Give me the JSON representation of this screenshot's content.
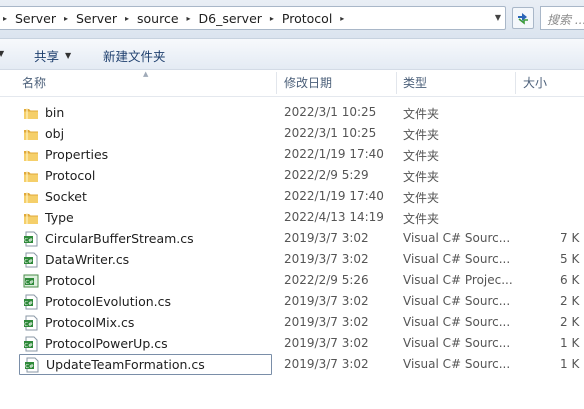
{
  "address": {
    "crumbs": [
      "Server",
      "Server",
      "source",
      "D6_server",
      "Protocol"
    ],
    "search_placeholder": "搜索 ..."
  },
  "toolbar": {
    "share_label": "共享",
    "new_folder_label": "新建文件夹"
  },
  "columns": {
    "name": "名称",
    "date": "修改日期",
    "type": "类型",
    "size": "大小"
  },
  "colors": {
    "folder": "#e8b84a",
    "selection_border": "#7a8ea8",
    "link_text": "#1e3f6e"
  },
  "files": [
    {
      "name": "bin",
      "date": "2022/3/1 10:25",
      "type": "文件夹",
      "size": "",
      "icon": "folder-icon"
    },
    {
      "name": "obj",
      "date": "2022/3/1 10:25",
      "type": "文件夹",
      "size": "",
      "icon": "folder-icon"
    },
    {
      "name": "Properties",
      "date": "2022/1/19 17:40",
      "type": "文件夹",
      "size": "",
      "icon": "folder-icon"
    },
    {
      "name": "Protocol",
      "date": "2022/2/9 5:29",
      "type": "文件夹",
      "size": "",
      "icon": "folder-icon"
    },
    {
      "name": "Socket",
      "date": "2022/1/19 17:40",
      "type": "文件夹",
      "size": "",
      "icon": "folder-icon"
    },
    {
      "name": "Type",
      "date": "2022/4/13 14:19",
      "type": "文件夹",
      "size": "",
      "icon": "folder-icon"
    },
    {
      "name": "CircularBufferStream.cs",
      "date": "2019/3/7 3:02",
      "type": "Visual C# Sourc...",
      "size": "7 K",
      "icon": "csharp-file-icon"
    },
    {
      "name": "DataWriter.cs",
      "date": "2019/3/7 3:02",
      "type": "Visual C# Sourc...",
      "size": "5 K",
      "icon": "csharp-file-icon"
    },
    {
      "name": "Protocol",
      "date": "2022/2/9 5:26",
      "type": "Visual C# Projec...",
      "size": "6 K",
      "icon": "csharp-project-icon"
    },
    {
      "name": "ProtocolEvolution.cs",
      "date": "2019/3/7 3:02",
      "type": "Visual C# Sourc...",
      "size": "2 K",
      "icon": "csharp-file-icon"
    },
    {
      "name": "ProtocolMix.cs",
      "date": "2019/3/7 3:02",
      "type": "Visual C# Sourc...",
      "size": "2 K",
      "icon": "csharp-file-icon"
    },
    {
      "name": "ProtocolPowerUp.cs",
      "date": "2019/3/7 3:02",
      "type": "Visual C# Sourc...",
      "size": "1 K",
      "icon": "csharp-file-icon"
    },
    {
      "name": "UpdateTeamFormation.cs",
      "date": "2019/3/7 3:02",
      "type": "Visual C# Sourc...",
      "size": "1 K",
      "icon": "csharp-file-icon",
      "selected": true
    }
  ]
}
